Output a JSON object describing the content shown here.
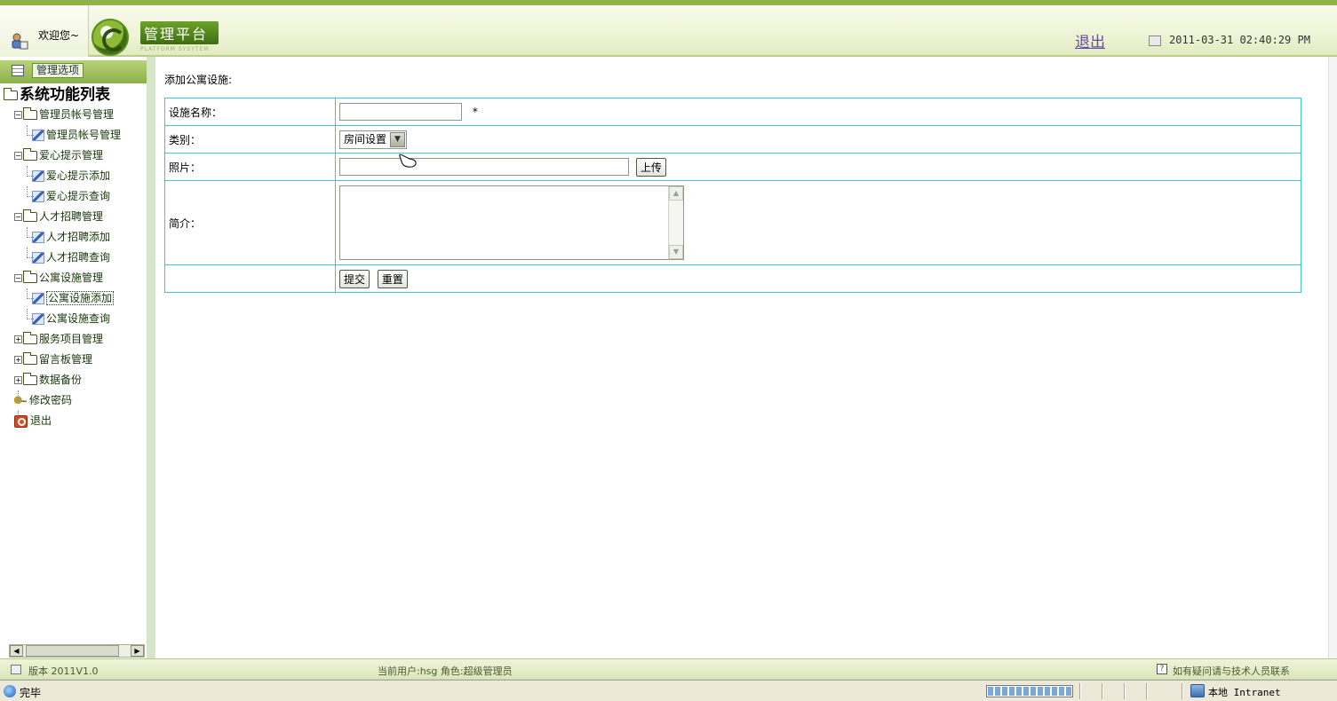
{
  "header": {
    "welcome": "欢迎您~",
    "brand_title": "管理平台",
    "brand_subtitle": "PLATFORM SYSYTEM",
    "logout": "退出",
    "datetime": "2011-03-31 02:40:29 PM"
  },
  "sidebar": {
    "tab_label": "管理选项",
    "tree_title": "系统功能列表",
    "groups": [
      {
        "label": "管理员帐号管理",
        "expanded": true,
        "items": [
          "管理员帐号管理"
        ]
      },
      {
        "label": "爱心提示管理",
        "expanded": true,
        "items": [
          "爱心提示添加",
          "爱心提示查询"
        ]
      },
      {
        "label": "人才招聘管理",
        "expanded": true,
        "items": [
          "人才招聘添加",
          "人才招聘查询"
        ]
      },
      {
        "label": "公寓设施管理",
        "expanded": true,
        "items": [
          "公寓设施添加",
          "公寓设施查询"
        ],
        "active_item": "公寓设施添加"
      },
      {
        "label": "服务项目管理",
        "expanded": false,
        "items": []
      },
      {
        "label": "留言板管理",
        "expanded": false,
        "items": []
      },
      {
        "label": "数据备份",
        "expanded": false,
        "items": []
      }
    ],
    "extra": {
      "change_password": "修改密码",
      "logout": "退出"
    },
    "expand_minus": "−",
    "expand_plus": "+"
  },
  "main": {
    "title": "添加公寓设施:",
    "form": {
      "name_label": "设施名称：",
      "name_value": "",
      "required_mark": "*",
      "category_label": "类别：",
      "category_value": "房间设置",
      "photo_label": "照片：",
      "photo_value": "",
      "upload_button": "上传",
      "intro_label": "简介：",
      "intro_value": "",
      "submit_button": "提交",
      "reset_button": "重置"
    }
  },
  "footer": {
    "version": "版本 2011V1.0",
    "current_user": "当前用户:hsg  角色:超级管理员",
    "help": "如有疑问请与技术人员联系"
  },
  "browser_status": {
    "status": "完毕",
    "zone": "本地 Intranet"
  },
  "icons": {
    "user": "user-icon",
    "logo": "target-logo-icon",
    "clock": "clock-icon",
    "folder": "folder-icon",
    "page": "pencil-page-icon",
    "key": "key-icon",
    "power": "power-icon",
    "help": "help-icon",
    "globe": "globe-icon"
  },
  "colors": {
    "accent_green": "#8fb24a",
    "table_border": "#3cc8d5",
    "link_purple": "#6a4aa7"
  }
}
